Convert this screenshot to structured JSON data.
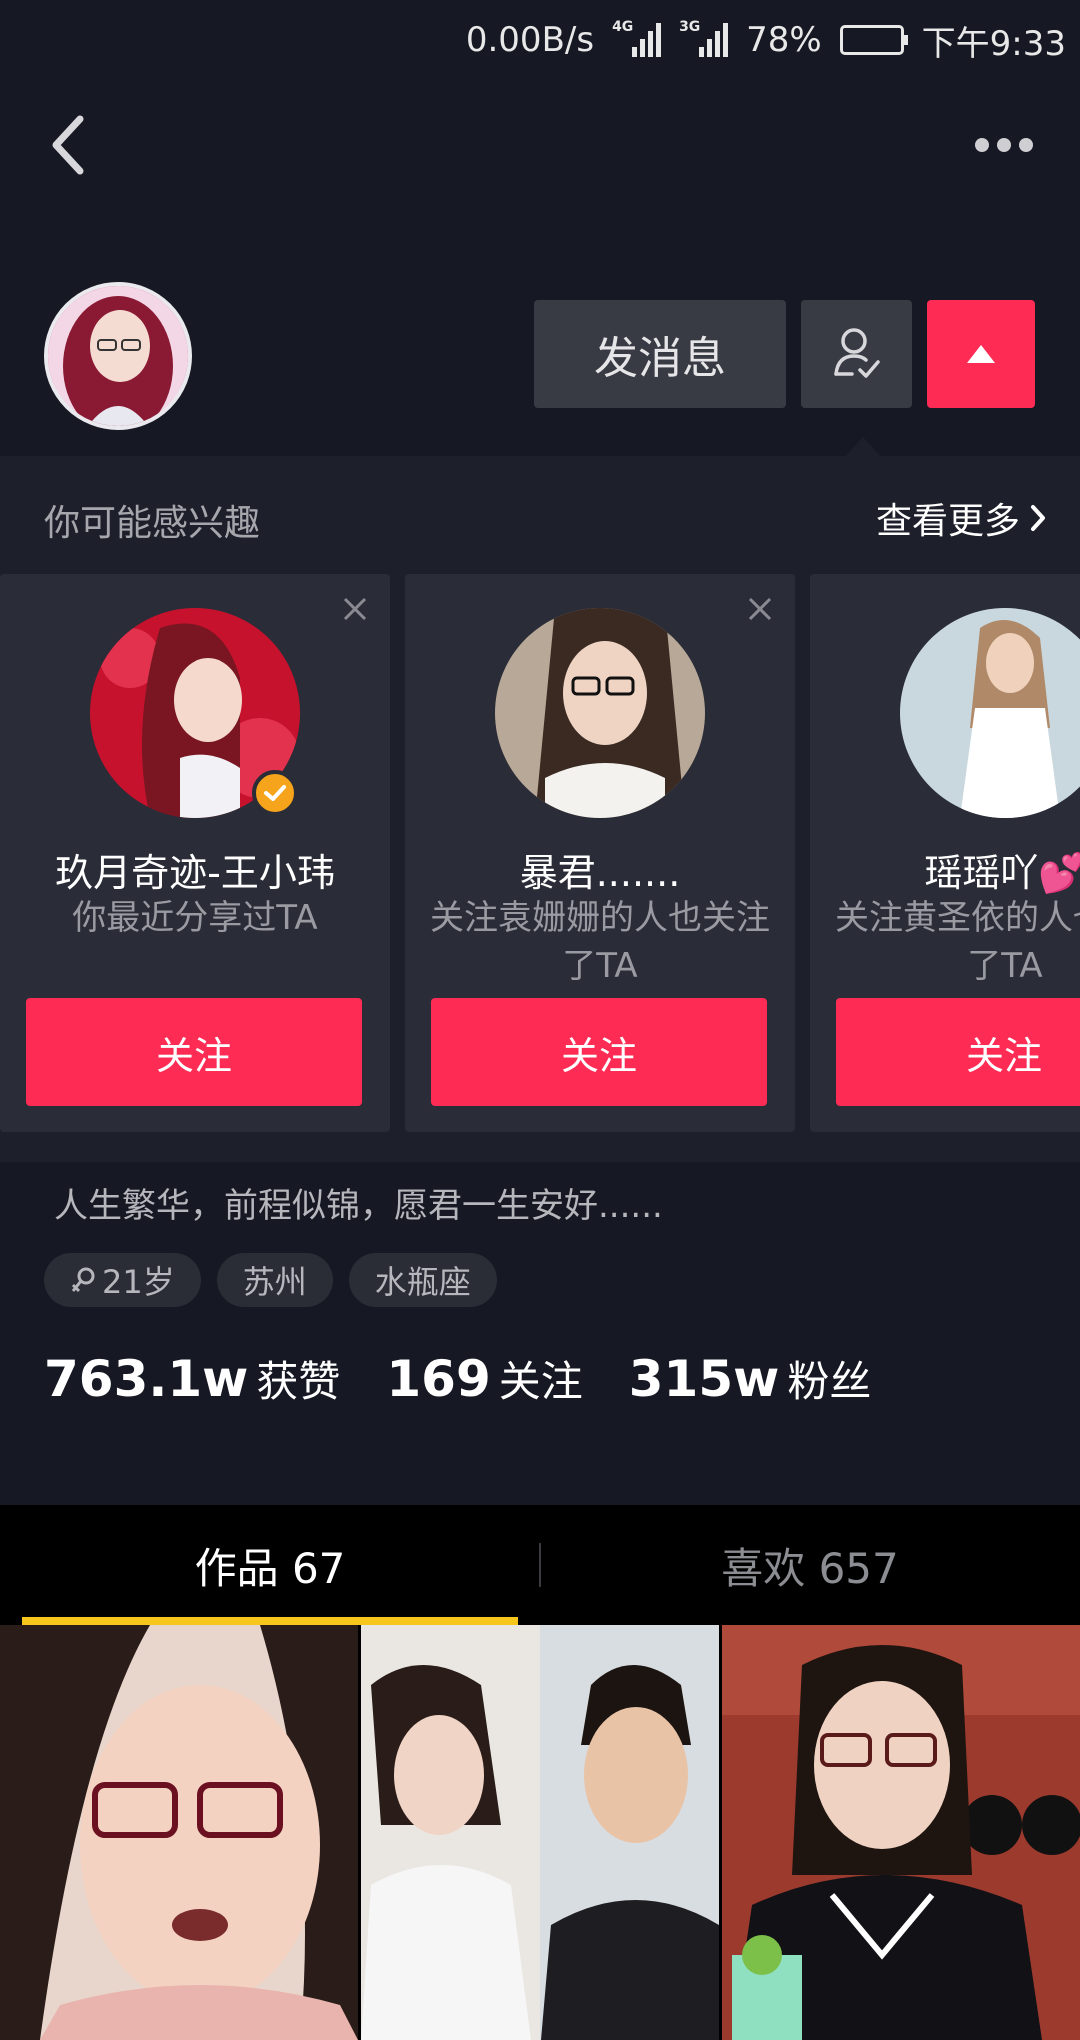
{
  "status_bar": {
    "speed": "0.00B/s",
    "net1": "4G",
    "net2": "3G",
    "battery": "78%",
    "battery_level": 0.78,
    "time": "下午9:33"
  },
  "header": {
    "back_icon": "chevron-left-icon",
    "more_icon": "more-dots-icon"
  },
  "profile_actions": {
    "message_label": "发消息",
    "friend_icon": "user-check-icon",
    "toggle_icon": "triangle-up-icon"
  },
  "suggestions": {
    "title": "你可能感兴趣",
    "see_more": "查看更多",
    "cards": [
      {
        "name": "玖月奇迹-王小玮",
        "reason": "你最近分享过TA",
        "follow_label": "关注",
        "verified": true
      },
      {
        "name": "暴君.......",
        "reason": "关注袁姗姗的人也关注了TA",
        "follow_label": "关注",
        "verified": false
      },
      {
        "name": "瑶瑶吖💕",
        "reason": "关注黄圣依的人也关注了TA",
        "follow_label": "关注",
        "verified": false
      }
    ]
  },
  "profile": {
    "bio": "人生繁华，前程似锦，愿君一生安好......",
    "tags": [
      "21岁",
      "苏州",
      "水瓶座"
    ],
    "stats": [
      {
        "num": "763.1w",
        "label": "获赞"
      },
      {
        "num": "169",
        "label": "关注"
      },
      {
        "num": "315w",
        "label": "粉丝"
      }
    ]
  },
  "tabs": {
    "works": "作品 67",
    "likes": "喜欢 657"
  },
  "colors": {
    "background": "#161823",
    "accent": "#fe2c55",
    "tab_indicator": "#f6c61c",
    "verified": "#f6a41c"
  }
}
